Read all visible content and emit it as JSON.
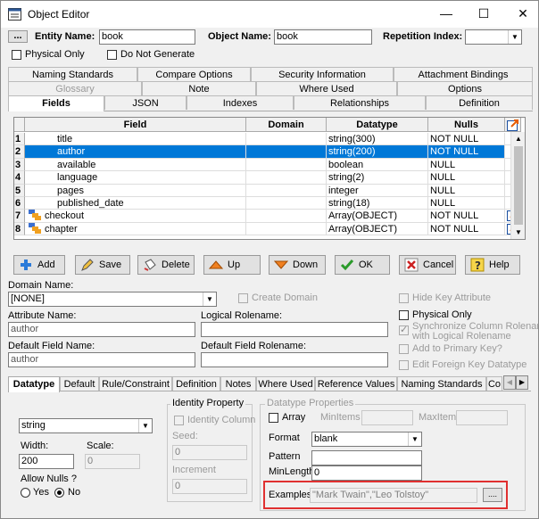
{
  "window": {
    "title": "Object Editor",
    "minimize": "—",
    "maximize": "☐",
    "close": "✕"
  },
  "header": {
    "dots_button": "...",
    "entity_name_label": "Entity Name:",
    "entity_name_value": "book",
    "object_name_label": "Object Name:",
    "object_name_value": "book",
    "repetition_label": "Repetition Index:",
    "repetition_value": "",
    "physical_only": "Physical Only",
    "do_not_generate": "Do Not Generate"
  },
  "tabs": {
    "row1": [
      "Naming Standards",
      "Compare Options",
      "Security Information",
      "Attachment Bindings"
    ],
    "row2": [
      "Glossary",
      "Note",
      "Where Used",
      "Options"
    ],
    "row3": [
      "Fields",
      "JSON",
      "Indexes",
      "Relationships",
      "Definition"
    ]
  },
  "grid": {
    "columns": [
      "Field",
      "Domain",
      "Datatype",
      "Nulls"
    ],
    "rows": [
      {
        "num": "1",
        "field": "title",
        "domain": "",
        "datatype": "string(300)",
        "nulls": "NOT NULL",
        "icon": "",
        "link": false
      },
      {
        "num": "2",
        "field": "author",
        "domain": "",
        "datatype": "string(200)",
        "nulls": "NOT NULL",
        "icon": "",
        "link": false,
        "selected": true
      },
      {
        "num": "3",
        "field": "available",
        "domain": "",
        "datatype": "boolean",
        "nulls": "NULL",
        "icon": "",
        "link": false
      },
      {
        "num": "4",
        "field": "language",
        "domain": "",
        "datatype": "string(2)",
        "nulls": "NULL",
        "icon": "",
        "link": false
      },
      {
        "num": "5",
        "field": "pages",
        "domain": "",
        "datatype": "integer",
        "nulls": "NULL",
        "icon": "",
        "link": false
      },
      {
        "num": "6",
        "field": "published_date",
        "domain": "",
        "datatype": "string(18)",
        "nulls": "NULL",
        "icon": "",
        "link": false
      },
      {
        "num": "7",
        "field": "checkout",
        "domain": "",
        "datatype": "Array(OBJECT)",
        "nulls": "NOT NULL",
        "icon": "object-icon",
        "link": true
      },
      {
        "num": "8",
        "field": "chapter",
        "domain": "",
        "datatype": "Array(OBJECT)",
        "nulls": "NOT NULL",
        "icon": "object-icon",
        "link": true
      }
    ]
  },
  "buttons": {
    "add": "Add",
    "save": "Save",
    "delete": "Delete",
    "up": "Up",
    "down": "Down",
    "ok": "OK",
    "cancel": "Cancel",
    "help": "Help"
  },
  "attr": {
    "domain_name_label": "Domain Name:",
    "domain_name_value": "[NONE]",
    "create_domain": "Create Domain",
    "attribute_name_label": "Attribute Name:",
    "attribute_name_value": "author",
    "logical_rolename_label": "Logical Rolename:",
    "logical_rolename_value": "",
    "default_field_name_label": "Default Field Name:",
    "default_field_name_value": "author",
    "default_field_rolename_label": "Default Field Rolename:",
    "default_field_rolename_value": "",
    "hide_key": "Hide Key Attribute",
    "physical_only": "Physical Only",
    "sync_column": "Synchronize Column Rolename",
    "sync_column_2": "with Logical Rolename",
    "add_primary_key": "Add to Primary Key?",
    "edit_foreign_key": "Edit Foreign Key Datatype"
  },
  "bottom_tabs": [
    "Datatype",
    "Default",
    "Rule/Constraint",
    "Definition",
    "Notes",
    "Where Used",
    "Reference Values",
    "Naming Standards",
    "Co"
  ],
  "datatype": {
    "type_value": "string",
    "width_label": "Width:",
    "width_value": "200",
    "scale_label": "Scale:",
    "scale_value": "0",
    "allow_nulls_label": "Allow Nulls ?",
    "yes": "Yes",
    "no": "No",
    "identity_property": "Identity Property",
    "identity_column": "Identity Column",
    "seed_label": "Seed:",
    "seed_value": "0",
    "increment_label": "Increment",
    "increment_value": "0",
    "properties_title": "Datatype Properties",
    "array": "Array",
    "min_items": "MinItems",
    "max_items": "MaxItems",
    "format_label": "Format",
    "format_value": "blank",
    "pattern_label": "Pattern",
    "pattern_value": "",
    "min_length_label": "MinLength",
    "min_length_value": "0",
    "examples_label": "Examples",
    "examples_value": "\"Mark Twain\",\"Leo Tolstoy\"",
    "examples_button": "...."
  },
  "colors": {
    "selection": "#0078d7",
    "highlight_border": "#e03030"
  }
}
